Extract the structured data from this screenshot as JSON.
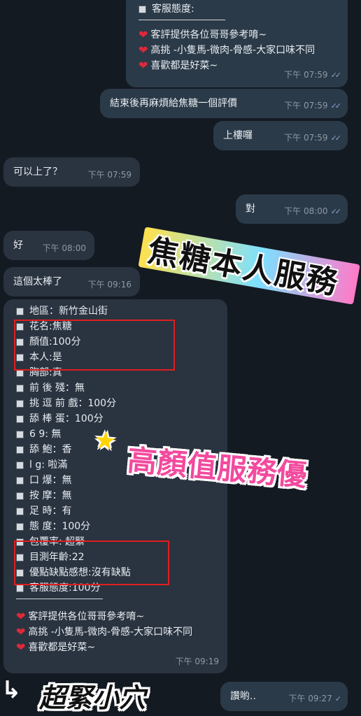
{
  "colors": {
    "outgoing": "#2b3a48",
    "incoming": "#2a3340",
    "read_ticks": "#7fa6d4",
    "highlight": "#e01e1e"
  },
  "icons": {
    "bullet": "black-square-icon",
    "heart": "red-heart-icon",
    "ticks": "double-check-icon",
    "star": "star-icon",
    "arrow": "arrow-icon"
  },
  "msg1": {
    "service_label": "客服態度:",
    "line1": "客評提供各位哥哥參考唷~",
    "line2": "高挑 -小隻馬-微肉-骨感-大家口味不同",
    "line3": "喜歡都是好菜~",
    "time": "下午 07:59",
    "ticks": "✓✓"
  },
  "msg2": {
    "text": "結束後再麻煩給焦糖一個評價",
    "time": "下午 07:59",
    "ticks": "✓✓"
  },
  "msg3": {
    "text": "上樓囉",
    "time": "下午 07:59",
    "ticks": "✓✓"
  },
  "msg4": {
    "text": "可以上了？",
    "time": "下午 07:59"
  },
  "msg5": {
    "text": "對",
    "time": "下午 08:00",
    "ticks": "✓✓"
  },
  "msg6": {
    "text": "好",
    "time": "下午 08:00"
  },
  "msg7": {
    "text": "這個太棒了",
    "time": "下午 09:16"
  },
  "review": {
    "items": [
      "地區：新竹金山街",
      "花名:焦糖",
      "顏值:100分",
      "本人:是",
      "胸部:真",
      "前 後 殘：無",
      "挑 逗 前 戲：100分",
      "舔 棒 蛋：100分",
      "6 9: 無",
      "舔 鮑：香",
      "l g: 啦滿",
      "口 爆：無",
      "按 摩：無",
      "足 時：有",
      "態 度：100分",
      "包覆率: 超緊",
      "目測年齡:22",
      "優點缺點感想:沒有缺點",
      "客服態度:100分"
    ],
    "line1": "客評提供各位哥哥參考唷~",
    "line2": "高挑 -小隻馬-微肉-骨感-大家口味不同",
    "line3": "喜歡都是好菜~",
    "time": "下午 09:19"
  },
  "msg9": {
    "text": "讚喲..",
    "time": "下午 09:27",
    "ticks": "✓"
  },
  "stickers": {
    "banner1": "焦糖本人服務",
    "banner2": "高顏值服務優",
    "banner3": "超緊小穴",
    "star": "★",
    "arrow": "↳"
  }
}
